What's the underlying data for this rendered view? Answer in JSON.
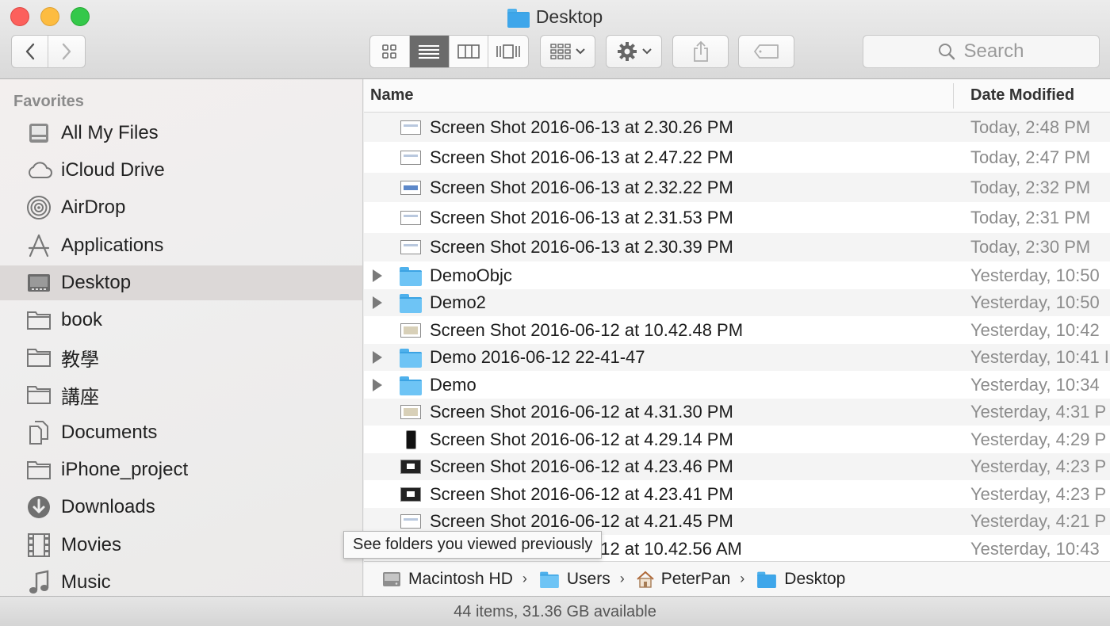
{
  "window": {
    "title": "Desktop"
  },
  "toolbar": {
    "search_placeholder": "Search",
    "view_modes": [
      "icon-view",
      "list-view",
      "column-view",
      "cover-flow-view"
    ],
    "active_view": "list-view"
  },
  "sidebar": {
    "section_title": "Favorites",
    "items": [
      {
        "label": "All My Files",
        "icon": "all-files-icon"
      },
      {
        "label": "iCloud Drive",
        "icon": "cloud-icon"
      },
      {
        "label": "AirDrop",
        "icon": "airdrop-icon"
      },
      {
        "label": "Applications",
        "icon": "applications-icon"
      },
      {
        "label": "Desktop",
        "icon": "desktop-icon",
        "selected": true
      },
      {
        "label": "book",
        "icon": "folder-icon"
      },
      {
        "label": "教學",
        "icon": "folder-icon"
      },
      {
        "label": "講座",
        "icon": "folder-icon"
      },
      {
        "label": "Documents",
        "icon": "documents-icon"
      },
      {
        "label": "iPhone_project",
        "icon": "folder-icon"
      },
      {
        "label": "Downloads",
        "icon": "downloads-icon"
      },
      {
        "label": "Movies",
        "icon": "movies-icon"
      },
      {
        "label": "Music",
        "icon": "music-icon"
      }
    ]
  },
  "list": {
    "columns": {
      "name": "Name",
      "date": "Date Modified"
    },
    "rows": [
      {
        "name": "Screen Shot 2016-06-13 at 2.30.26 PM",
        "date": "Today, 2:48 PM",
        "kind": "screenshot"
      },
      {
        "name": "Screen Shot 2016-06-13 at 2.47.22 PM",
        "date": "Today, 2:47 PM",
        "kind": "screenshot"
      },
      {
        "name": "Screen Shot 2016-06-13 at 2.32.22 PM",
        "date": "Today, 2:32 PM",
        "kind": "screenshot-v2"
      },
      {
        "name": "Screen Shot 2016-06-13 at 2.31.53 PM",
        "date": "Today, 2:31 PM",
        "kind": "screenshot"
      },
      {
        "name": "Screen Shot 2016-06-13 at 2.30.39 PM",
        "date": "Today, 2:30 PM",
        "kind": "screenshot"
      },
      {
        "name": "DemoObjc",
        "date": "Yesterday, 10:50",
        "kind": "folder"
      },
      {
        "name": "Demo2",
        "date": "Yesterday, 10:50",
        "kind": "folder"
      },
      {
        "name": "Screen Shot 2016-06-12 at 10.42.48 PM",
        "date": "Yesterday, 10:42",
        "kind": "screenshot-v3"
      },
      {
        "name": "Demo 2016-06-12 22-41-47",
        "date": "Yesterday, 10:41 I",
        "kind": "folder"
      },
      {
        "name": "Demo",
        "date": "Yesterday, 10:34",
        "kind": "folder"
      },
      {
        "name": "Screen Shot 2016-06-12 at 4.31.30 PM",
        "date": "Yesterday, 4:31 P",
        "kind": "screenshot-v3"
      },
      {
        "name": "Screen Shot 2016-06-12 at 4.29.14 PM",
        "date": "Yesterday, 4:29 P",
        "kind": "phone"
      },
      {
        "name": "Screen Shot 2016-06-12 at 4.23.46 PM",
        "date": "Yesterday, 4:23 P",
        "kind": "dark"
      },
      {
        "name": "Screen Shot 2016-06-12 at 4.23.41 PM",
        "date": "Yesterday, 4:23 P",
        "kind": "dark"
      },
      {
        "name": "Screen Shot 2016-06-12 at 4.21.45 PM",
        "date": "Yesterday, 4:21 P",
        "kind": "screenshot"
      },
      {
        "name": "Screen Shot 2016-06-12 at 10.42.56 AM",
        "date": "Yesterday, 10:43",
        "kind": "screenshot"
      }
    ]
  },
  "pathbar": [
    {
      "label": "Macintosh HD",
      "icon": "hard-drive-icon"
    },
    {
      "label": "Users",
      "icon": "users-folder-icon"
    },
    {
      "label": "PeterPan",
      "icon": "home-icon"
    },
    {
      "label": "Desktop",
      "icon": "desktop-folder-icon"
    }
  ],
  "status": "44 items, 31.36 GB available",
  "tooltip": "See folders you viewed previously"
}
